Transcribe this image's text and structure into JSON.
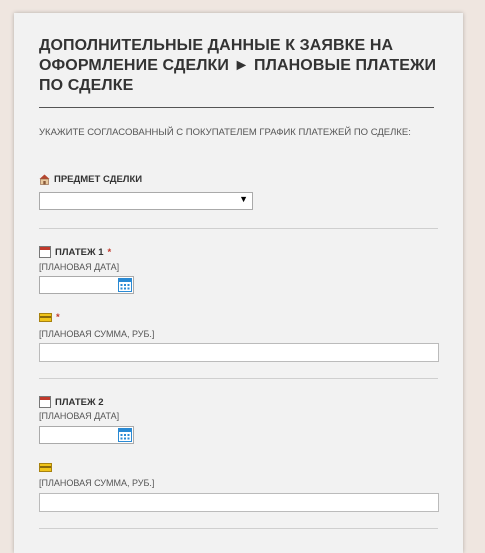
{
  "form": {
    "title": "ДОПОЛНИТЕЛЬНЫЕ ДАННЫЕ К ЗАЯВКЕ НА ОФОРМЛЕНИЕ СДЕЛКИ ► ПЛАНОВЫЕ ПЛАТЕЖИ ПО СДЕЛКЕ",
    "instruction": "УКАЖИТЕ СОГЛАСОВАННЫЙ С ПОКУПАТЕЛЕМ ГРАФИК ПЛАТЕЖЕЙ ПО СДЕЛКЕ:",
    "subject": {
      "label": "ПРЕДМЕТ СДЕЛКИ",
      "icon": "house-icon",
      "selected_value": "",
      "arrow": "▼"
    },
    "payments": [
      {
        "label": "ПЛАТЕЖ 1",
        "required_mark": "*",
        "date_hint": "[ПЛАНОВАЯ ДАТА]",
        "date_value": "",
        "amount_required_mark": "*",
        "amount_hint": "[ПЛАНОВАЯ СУММА, РУБ.]",
        "amount_value": ""
      },
      {
        "label": "ПЛАТЕЖ 2",
        "required_mark": "",
        "date_hint": "[ПЛАНОВАЯ ДАТА]",
        "date_value": "",
        "amount_required_mark": "",
        "amount_hint": "[ПЛАНОВАЯ СУММА, РУБ.]",
        "amount_value": ""
      }
    ]
  },
  "colors": {
    "background": "#efe6e0",
    "panel": "#f2f2f2",
    "required": "#c0392b",
    "calendar_accent": "#2a8ad4"
  }
}
